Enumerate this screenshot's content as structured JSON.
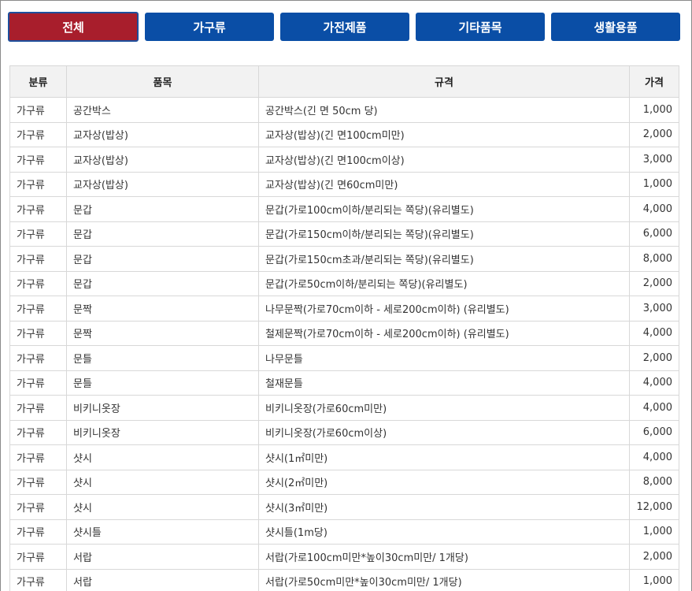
{
  "tabs": [
    {
      "label": "전체",
      "active": true
    },
    {
      "label": "가구류",
      "active": false
    },
    {
      "label": "가전제품",
      "active": false
    },
    {
      "label": "기타품목",
      "active": false
    },
    {
      "label": "생활용품",
      "active": false
    }
  ],
  "table": {
    "headers": [
      "분류",
      "품목",
      "규격",
      "가격"
    ],
    "rows": [
      [
        "가구류",
        "공간박스",
        "공간박스(긴 면 50cm 당)",
        "1,000"
      ],
      [
        "가구류",
        "교자상(밥상)",
        "교자상(밥상)(긴 면100cm미만)",
        "2,000"
      ],
      [
        "가구류",
        "교자상(밥상)",
        "교자상(밥상)(긴 면100cm이상)",
        "3,000"
      ],
      [
        "가구류",
        "교자상(밥상)",
        "교자상(밥상)(긴 면60cm미만)",
        "1,000"
      ],
      [
        "가구류",
        "문갑",
        "문갑(가로100cm이하/분리되는 쪽당)(유리별도)",
        "4,000"
      ],
      [
        "가구류",
        "문갑",
        "문갑(가로150cm이하/분리되는 쪽당)(유리별도)",
        "6,000"
      ],
      [
        "가구류",
        "문갑",
        "문갑(가로150cm초과/분리되는 쪽당)(유리별도)",
        "8,000"
      ],
      [
        "가구류",
        "문갑",
        "문갑(가로50cm이하/분리되는 쪽당)(유리별도)",
        "2,000"
      ],
      [
        "가구류",
        "문짝",
        "나무문짝(가로70cm이하 - 세로200cm이하) (유리별도)",
        "3,000"
      ],
      [
        "가구류",
        "문짝",
        "철제문짝(가로70cm이하 - 세로200cm이하) (유리별도)",
        "4,000"
      ],
      [
        "가구류",
        "문틀",
        "나무문틀",
        "2,000"
      ],
      [
        "가구류",
        "문틀",
        "철재문틀",
        "4,000"
      ],
      [
        "가구류",
        "비키니옷장",
        "비키니옷장(가로60cm미만)",
        "4,000"
      ],
      [
        "가구류",
        "비키니옷장",
        "비키니옷장(가로60cm이상)",
        "6,000"
      ],
      [
        "가구류",
        "샷시",
        "샷시(1㎡미만)",
        "4,000"
      ],
      [
        "가구류",
        "샷시",
        "샷시(2㎡미만)",
        "8,000"
      ],
      [
        "가구류",
        "샷시",
        "샷시(3㎡미만)",
        "12,000"
      ],
      [
        "가구류",
        "샷시틀",
        "샷시틀(1m당)",
        "1,000"
      ],
      [
        "가구류",
        "서랍",
        "서랍(가로100cm미만*높이30cm미만/ 1개당)",
        "2,000"
      ],
      [
        "가구류",
        "서랍",
        "서랍(가로50cm미만*높이30cm미만/ 1개당)",
        "1,000"
      ]
    ]
  },
  "colors": {
    "tab_bg": "#0a4ea6",
    "tab_active_bg": "#a81e2c",
    "tab_active_border": "#1e4f9c",
    "header_bg": "#f2f2f2",
    "border": "#d8d8d8"
  }
}
